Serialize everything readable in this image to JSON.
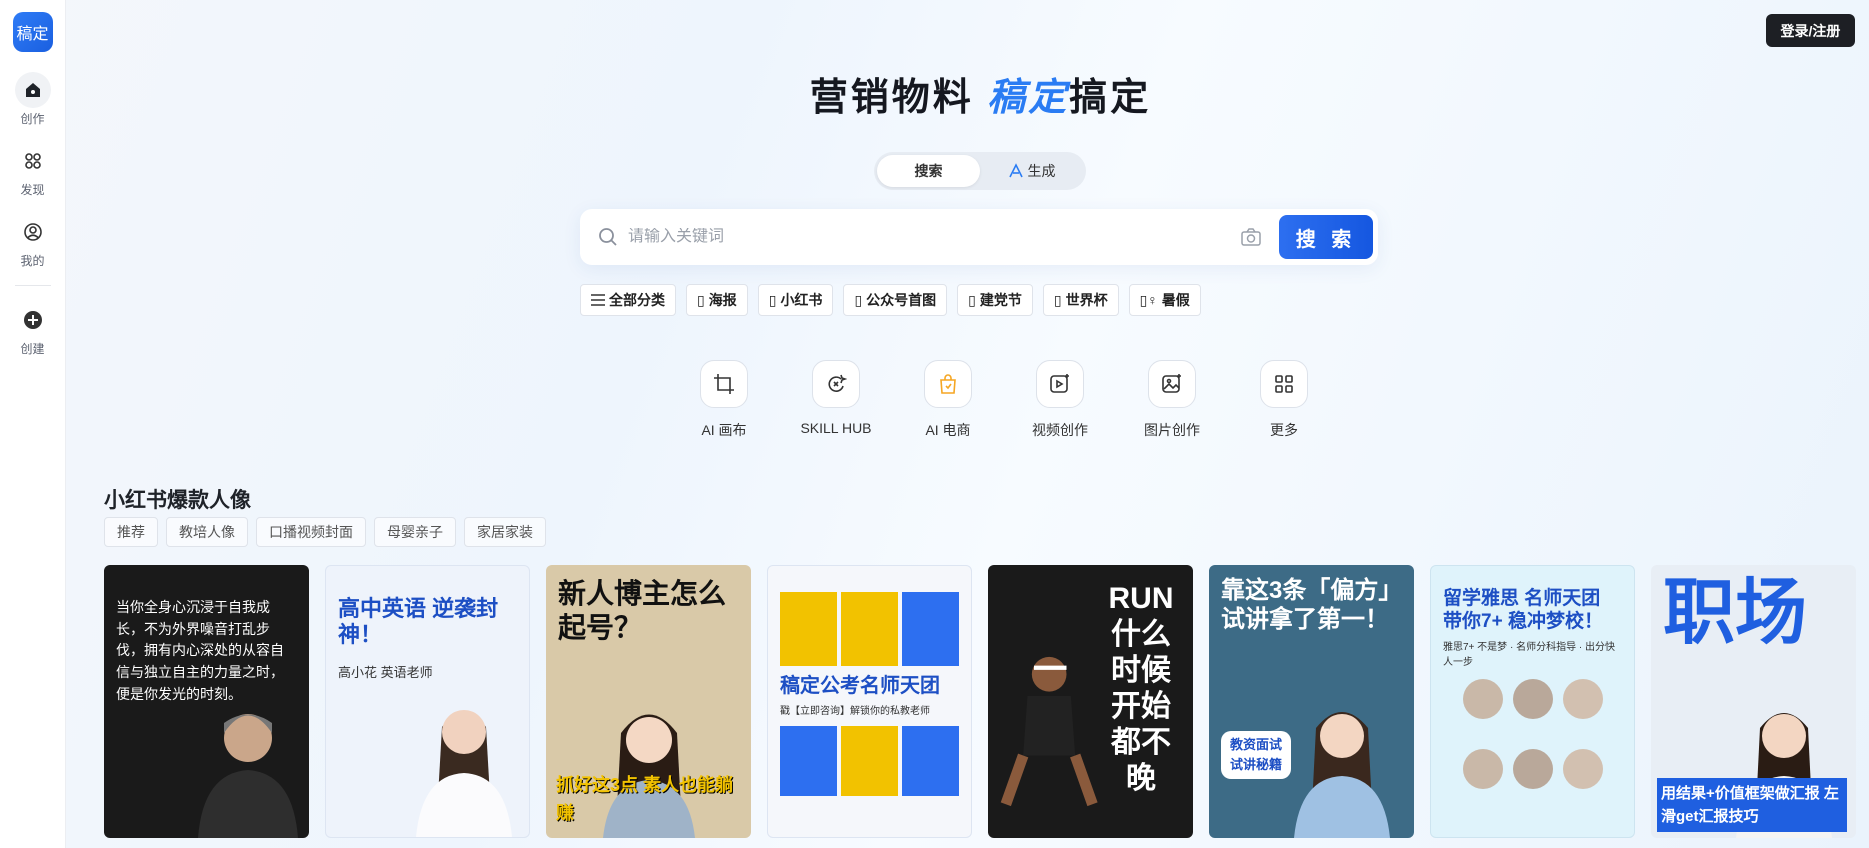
{
  "app": {
    "logo": "稿定"
  },
  "sidebar": {
    "items": [
      {
        "label": "创作",
        "icon": "home-icon"
      },
      {
        "label": "发现",
        "icon": "discover-icon"
      },
      {
        "label": "我的",
        "icon": "user-icon"
      },
      {
        "label": "创建",
        "icon": "plus-icon"
      }
    ]
  },
  "header": {
    "login": "登录/注册"
  },
  "hero": {
    "title_a": "营销物料 ",
    "title_accent": "稿定",
    "title_b": "搞定"
  },
  "modes": {
    "search": "搜索",
    "generate": "生成"
  },
  "search": {
    "placeholder": "请输入关键词",
    "button": "搜 索"
  },
  "categories": {
    "all": "全部分类",
    "chips": [
      "海报",
      "小红书",
      "公众号首图",
      "建党节",
      "世界杯",
      "暑假"
    ]
  },
  "tools": [
    {
      "label": "AI 画布",
      "icon": "canvas-icon"
    },
    {
      "label": "SKILL HUB",
      "icon": "skill-icon"
    },
    {
      "label": "AI 电商",
      "icon": "shopping-bag-icon"
    },
    {
      "label": "视频创作",
      "icon": "video-icon"
    },
    {
      "label": "图片创作",
      "icon": "image-icon"
    },
    {
      "label": "更多",
      "icon": "grid-icon"
    }
  ],
  "section": {
    "title": "小红书爆款人像",
    "tags": [
      "推荐",
      "教培人像",
      "口播视频封面",
      "母婴亲子",
      "家居家装"
    ]
  },
  "cards": [
    {
      "title": "",
      "body": "当你全身心沉浸于自我成长，不为外界噪音打乱步伐，拥有内心深处的从容自信与独立自主的力量之时，便是你发光的时刻。",
      "bg": "#1a1a1a",
      "color": "#ffffff"
    },
    {
      "title": "高中英语 逆袭封神！",
      "body": "高小花 英语老师",
      "bg": "#eef3fb",
      "color": "#1d4fc4"
    },
    {
      "title": "新人博主怎么起号？",
      "body": "抓好这3点 素人也能躺赚",
      "bg": "#d9c9a8",
      "color": "#111111"
    },
    {
      "title": "稿定公考名师天团",
      "body": "戳【立即咨询】解锁你的私教老师",
      "bg": "#f5f7fb",
      "color": "#1d4fc4"
    },
    {
      "title": "RUN 什么时候 开始 都不晚",
      "body": "",
      "bg": "#1a1a1a",
      "color": "#ffffff"
    },
    {
      "title": "靠这3条「偏方」试讲拿了第一！",
      "body": "教资面试 试讲秘籍",
      "bg": "#3d6b86",
      "color": "#ffffff"
    },
    {
      "title": "留学雅思 名师天团 带你7+ 稳冲梦校！",
      "body": "雅思7+ 不是梦 · 名师分科指导 · 出分快人一步",
      "bg": "#dff3fb",
      "color": "#1d4fc4"
    },
    {
      "title": "职场",
      "body": "用结果+价值框架做汇报 左滑get汇报技巧",
      "bg": "#e8eef5",
      "color": "#1f5fe0"
    }
  ]
}
